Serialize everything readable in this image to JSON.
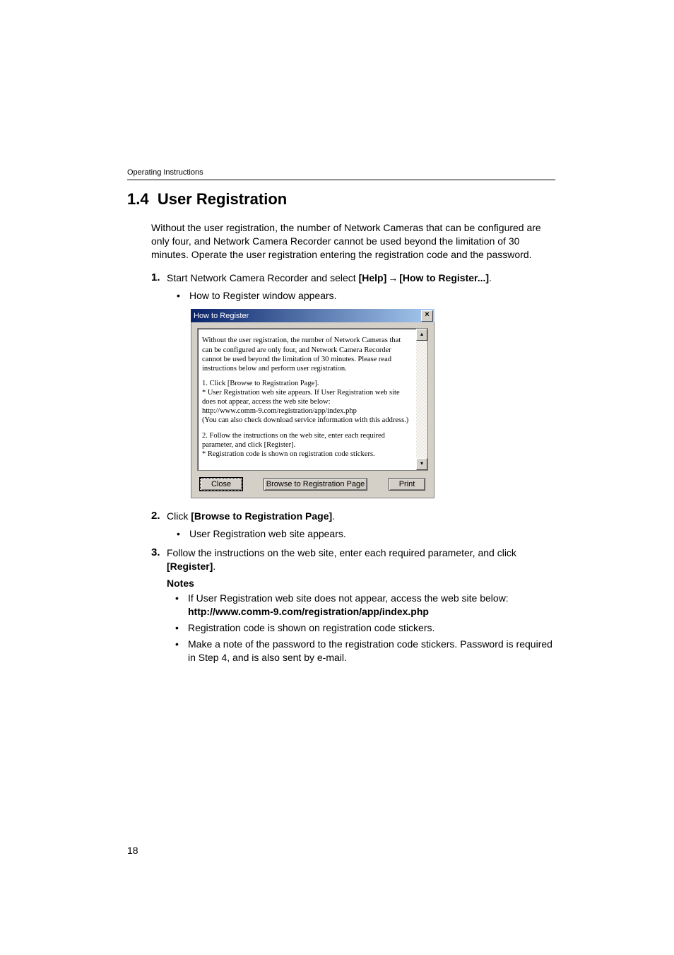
{
  "header": {
    "running": "Operating Instructions"
  },
  "section": {
    "number": "1.4",
    "title": "User Registration"
  },
  "intro": "Without the user registration, the number of Network Cameras that can be configured are only four, and Network Camera Recorder cannot be used beyond the limitation of 30 minutes. Operate the user registration entering the registration code and the password.",
  "steps": {
    "s1": {
      "num": "1.",
      "pre": "Start Network Camera Recorder and select ",
      "bold1": "[Help]",
      "arrow": " → ",
      "bold2": "[How to Register...]",
      "post": ".",
      "bullet": "How to Register window appears."
    },
    "s2": {
      "num": "2.",
      "pre": "Click ",
      "bold": "[Browse to Registration Page]",
      "post": ".",
      "bullet": "User Registration web site appears."
    },
    "s3": {
      "num": "3.",
      "pre": "Follow the instructions on the web site, enter each required parameter, and click ",
      "bold": "[Register]",
      "post": "."
    }
  },
  "notes": {
    "heading": "Notes",
    "n1_pre": "If User Registration web site does not appear, access the web site below:",
    "n1_url": "http://www.comm-9.com/registration/app/index.php",
    "n2": "Registration code is shown on registration code stickers.",
    "n3": "Make a note of the password to the registration code stickers. Password is required in Step 4, and is also sent by e-mail."
  },
  "dialog": {
    "title": "How to Register",
    "p1": "Without the user registration, the number of Network Cameras that can be configured are only four, and Network Camera Recorder cannot be used beyond the limitation of 30 minutes. Please read instructions below and perform user registration.",
    "p2a": "1. Click [Browse to Registration Page].",
    "p2b": "* User Registration web site appears. If User Registration web site does not appear, access the web site below:",
    "p2c": "http://www.comm-9.com/registration/app/index.php",
    "p2d": "(You can also check download service information with this address.)",
    "p3a": "2. Follow the instructions on the web site, enter each required parameter, and click [Register].",
    "p3b": "* Registration code is shown on registration code stickers.",
    "buttons": {
      "close": "Close",
      "browse": "Browse to Registration Page",
      "print": "Print"
    },
    "close_x": "×",
    "scroll_up": "▴",
    "scroll_down": "▾"
  },
  "page_number": "18"
}
